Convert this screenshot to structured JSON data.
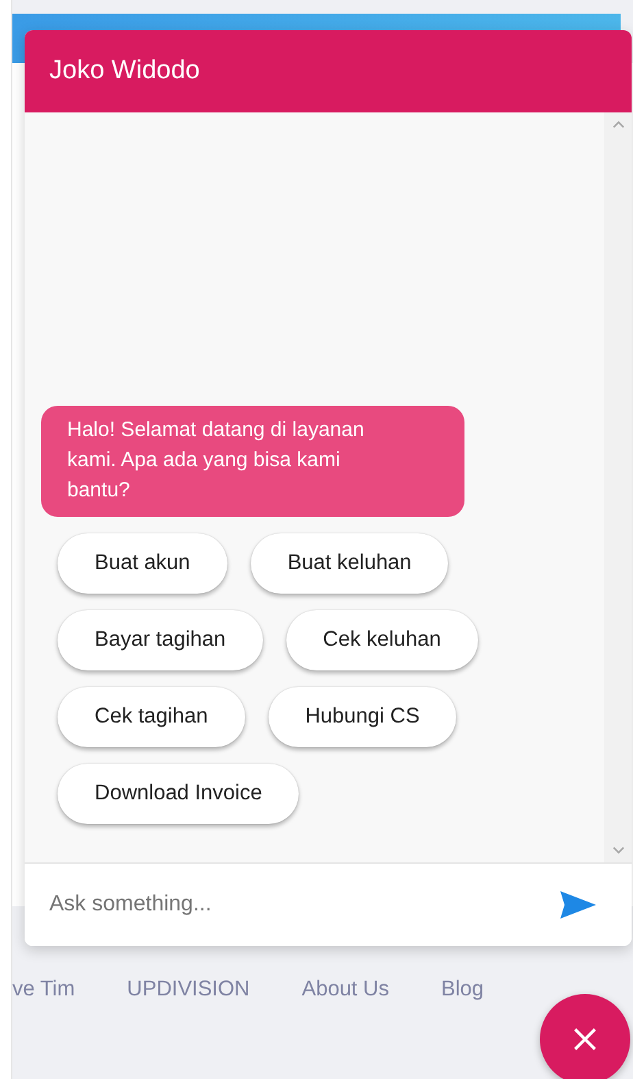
{
  "chat": {
    "title": "Joko Widodo",
    "messages": [
      {
        "text": "Halo! Selamat datang di layanan kami. Apa ada yang bisa kami bantu?"
      }
    ],
    "quick_replies": [
      "Buat akun",
      "Buat keluhan",
      "Bayar tagihan",
      "Cek keluhan",
      "Cek tagihan",
      "Hubungi CS",
      "Download Invoice"
    ],
    "input": {
      "placeholder": "Ask something..."
    }
  },
  "footer_links": [
    "ve Tim",
    "UPDIVISION",
    "About Us",
    "Blog"
  ]
}
